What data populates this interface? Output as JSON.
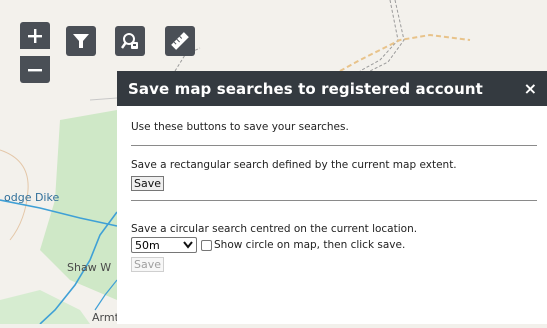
{
  "map": {
    "labels": {
      "dike": "odge Dike",
      "shaw": "Shaw W",
      "armt": "Armt"
    }
  },
  "controls": {
    "zoom_in_icon": "plus-icon",
    "zoom_out_icon": "minus-icon",
    "filter_icon": "filter-icon",
    "save_search_icon": "search-user-icon",
    "measure_icon": "ruler-icon"
  },
  "panel": {
    "title": "Save map searches to registered account",
    "close": "×",
    "intro": "Use these buttons to save your searches.",
    "rect_text": "Save a rectangular search defined by the current map extent.",
    "rect_button": "Save",
    "circle_text": "Save a circular search centred on the current location.",
    "radius_selected": "50m",
    "show_circle_label": "Show circle on map, then click save.",
    "show_circle_checked": false,
    "circle_button": "Save",
    "circle_button_disabled": true
  },
  "colors": {
    "header_bg": "#343a40",
    "button_bg": "#4a4f56",
    "water": "#3fa0d6",
    "woodland": "#cfe8c7"
  }
}
